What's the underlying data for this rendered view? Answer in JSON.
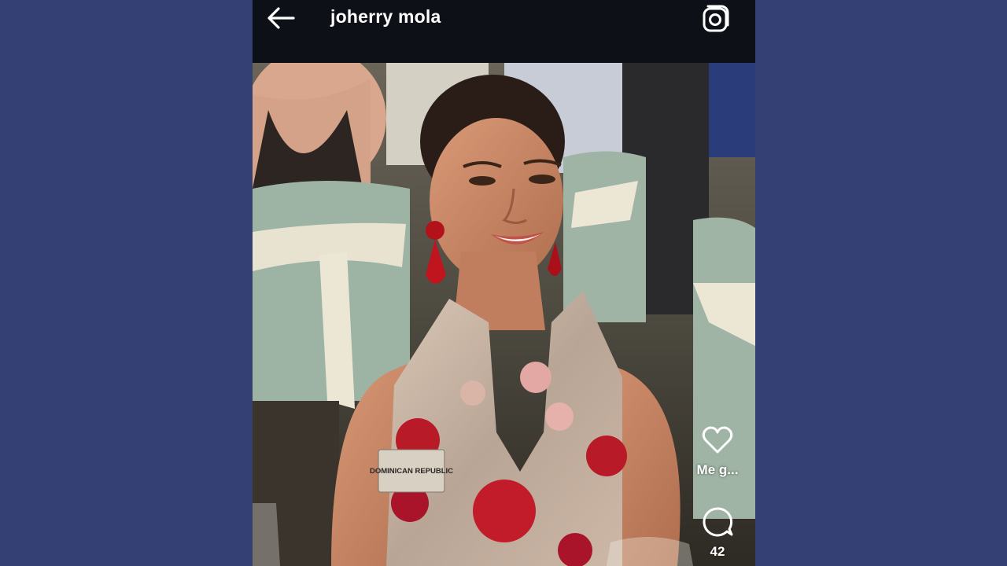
{
  "header": {
    "title": "joherry mola",
    "back_icon": "arrow-left-icon",
    "camera_icon": "camera-icon"
  },
  "post": {
    "image_alt": "Woman in floral halter dress smiling at a gala dinner",
    "name_badge": "DOMINICAN REPUBLIC"
  },
  "actions": {
    "like_label": "Me g...",
    "like_icon": "heart-icon",
    "comment_count": "42",
    "comment_icon": "comment-bubble-icon"
  },
  "colors": {
    "header_bg": "#0d1117",
    "page_bg": "#343f74",
    "icon_color": "#ffffff"
  }
}
